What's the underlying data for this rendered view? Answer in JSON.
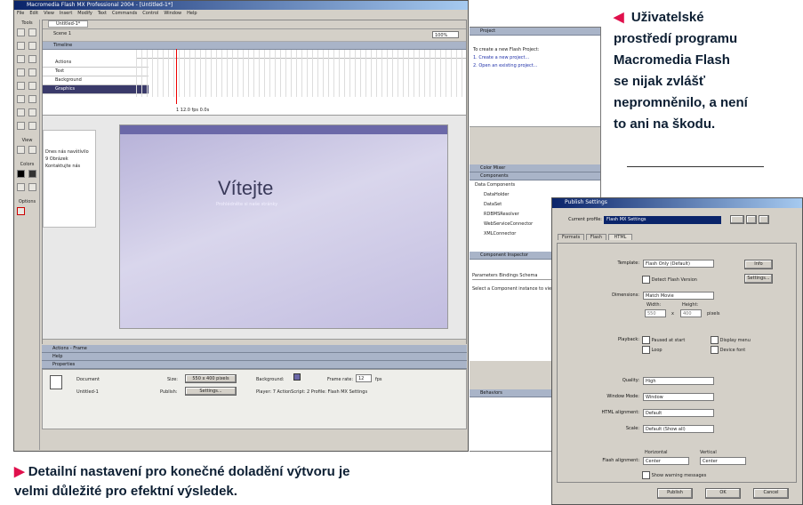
{
  "app": {
    "title": "Macromedia Flash MX Professional 2004 - [Untitled-1*]",
    "menu": [
      "File",
      "Edit",
      "View",
      "Insert",
      "Modify",
      "Text",
      "Commands",
      "Control",
      "Window",
      "Help"
    ],
    "doc_tab": "Untitled-1*",
    "scene": "Scene 1",
    "zoom": "100%",
    "timeline_header": "Timeline",
    "layers": [
      "Actions",
      "Text",
      "Background",
      "Graphics"
    ],
    "timeline_status": "1   12.0 fps   0.0s",
    "stage_title": "Vítejte",
    "stage_subtitle": "Prohlédněte si naše stránky",
    "stage_left_text": [
      "Dnes nás navštívilo",
      "9 Obrázek",
      "Kontaktujte nás"
    ],
    "panels_bottom": [
      "Actions - Frame",
      "Help",
      "Properties"
    ],
    "props": {
      "doc_label": "Document",
      "doc_name": "Untitled-1",
      "size_label": "Size:",
      "size_value": "550 x 400 pixels",
      "publish_label": "Publish:",
      "settings_btn": "Settings...",
      "bg_label": "Background:",
      "fps_label": "Frame rate:",
      "fps_value": "12",
      "fps_unit": "fps",
      "player_text": "Player: 7   ActionScript: 2   Profile: Flash MX Settings"
    },
    "right_panels": {
      "project": "Project",
      "project_text": [
        "To create a new Flash Project:",
        "1. Create a new project...",
        "2. Open an existing project..."
      ],
      "color_mixer": "Color Mixer",
      "components": "Components",
      "component_items": [
        "Data Components",
        "DataHolder",
        "DataSet",
        "RDBMSResolver",
        "WebServiceConnector",
        "XMLConnector"
      ],
      "component_inspector": "Component Inspector",
      "inspector_tabs": "Parameters  Bindings  Schema",
      "inspector_text": "Select a Component instance to view its parameters.",
      "behaviors": "Behaviors"
    },
    "tools_label": "Tools",
    "view_label": "View",
    "colors_label": "Colors",
    "options_label": "Options"
  },
  "dialog": {
    "title": "Publish Settings",
    "profile_label": "Current profile:",
    "profile_value": "Flash MX Settings",
    "tabs": [
      "Formats",
      "Flash",
      "HTML"
    ],
    "rows": [
      {
        "label": "Template:",
        "value": "Flash Only (Default)"
      },
      {
        "label": "Dimensions:",
        "value": "Match Movie"
      },
      {
        "label": "Playback:",
        "value": ""
      },
      {
        "label": "Quality:",
        "value": "High"
      },
      {
        "label": "Window Mode:",
        "value": "Window"
      },
      {
        "label": "HTML alignment:",
        "value": "Default"
      },
      {
        "label": "Scale:",
        "value": "Default (Show all)"
      },
      {
        "label": "Flash alignment:",
        "value": "Center"
      }
    ],
    "info_btn": "Info",
    "detect_label": "Detect Flash Version",
    "settings_btn": "Settings...",
    "width_label": "Width:",
    "height_label": "Height:",
    "width_value": "550",
    "height_value": "400",
    "pixels_label": "pixels",
    "paused": "Paused at start",
    "loop": "Loop",
    "display_menu": "Display menu",
    "device_font": "Device font",
    "horizontal": "Horizontal",
    "vertical": "Vertical",
    "flash_align_v": "Center",
    "show_warnings": "Show warning messages",
    "publish_btn": "Publish",
    "ok_btn": "OK",
    "cancel_btn": "Cancel"
  },
  "captions": {
    "right": "Uživatelské prostředí programu Macromedia Flash se nijak zvlášť nepromněnilo, a není to ani na škodu.",
    "right_lines": [
      "Uživatelské",
      "prostředí programu",
      "Macromedia Flash",
      "se nijak zvlášť",
      "nepromněnilo, a není",
      "to ani na škodu."
    ],
    "bottom_lines": [
      "Detailní nastavení pro konečné doladění výtvoru je",
      "velmi důležité pro efektní výsledek."
    ]
  },
  "colors": {
    "accent": "#e0104c",
    "stage_top": "#6b68a8",
    "stage_bg": "#c8c4e0"
  }
}
